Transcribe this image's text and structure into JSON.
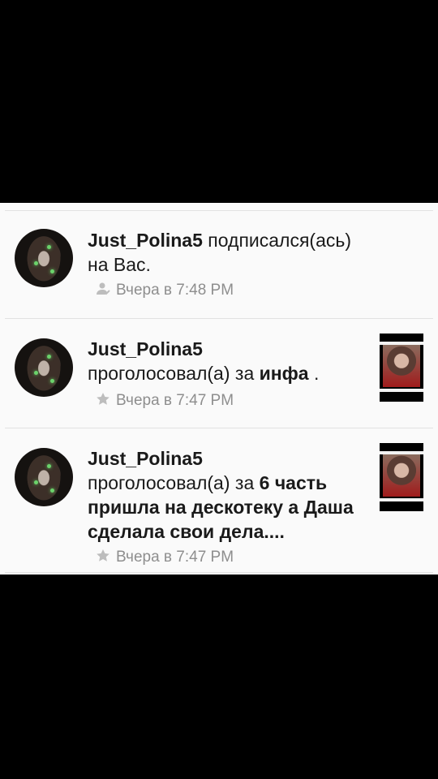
{
  "notifications": [
    {
      "username": "Just_Polina5",
      "action": "подписался(ась) на Вас.",
      "target": "",
      "suffix": "",
      "time": "Вчера в 7:48 PM",
      "icon": "follow-icon",
      "has_thumbnail": false
    },
    {
      "username": "Just_Polina5",
      "action": "проголосовал(а) за",
      "target": "инфа",
      "suffix": " .",
      "time": "Вчера в 7:47 PM",
      "icon": "star-icon",
      "has_thumbnail": true
    },
    {
      "username": "Just_Polina5",
      "action": "проголосовал(а) за",
      "target": "6 часть пришла на дескотеку а Даша сделала свои дела....",
      "suffix": "",
      "time": "Вчера в 7:47 PM",
      "icon": "star-icon",
      "has_thumbnail": true
    }
  ],
  "colors": {
    "background": "#000000",
    "panel": "#fafafa",
    "text": "#1a1a1a",
    "meta": "#8e8e8e",
    "divider": "#e2e2e2"
  }
}
